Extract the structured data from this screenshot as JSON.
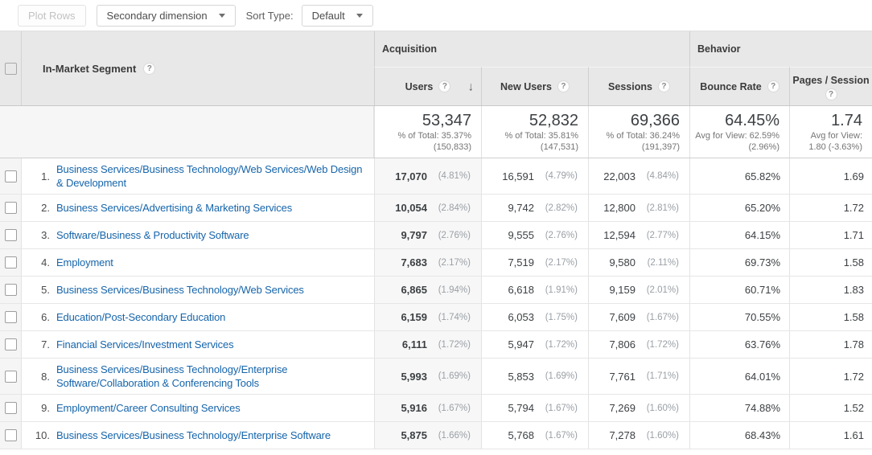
{
  "toolbar": {
    "plot_rows_label": "Plot Rows",
    "secondary_dimension_label": "Secondary dimension",
    "sort_type_label": "Sort Type:",
    "sort_type_value": "Default"
  },
  "table": {
    "dimension_header": "In-Market Segment",
    "help_glyph": "?",
    "sort_arrow_glyph": "↓",
    "groups": {
      "acquisition": "Acquisition",
      "behavior": "Behavior"
    },
    "columns": {
      "users": "Users",
      "new_users": "New Users",
      "sessions": "Sessions",
      "bounce_rate": "Bounce Rate",
      "pages_per_session": "Pages / Session"
    },
    "totals": {
      "users": {
        "value": "53,347",
        "sub1": "% of Total: 35.37%",
        "sub2": "(150,833)"
      },
      "new_users": {
        "value": "52,832",
        "sub1": "% of Total: 35.81%",
        "sub2": "(147,531)"
      },
      "sessions": {
        "value": "69,366",
        "sub1": "% of Total: 36.24%",
        "sub2": "(191,397)"
      },
      "bounce_rate": {
        "value": "64.45%",
        "sub1": "Avg for View: 62.59%",
        "sub2": "(2.96%)"
      },
      "pages_per_session": {
        "value": "1.74",
        "sub1": "Avg for View:",
        "sub2": "1.80 (-3.63%)"
      }
    },
    "rows": [
      {
        "rank": "1.",
        "segment": "Business Services/Business Technology/Web Services/Web Design & Development",
        "users": "17,070",
        "users_pct": "(4.81%)",
        "new_users": "16,591",
        "new_users_pct": "(4.79%)",
        "sessions": "22,003",
        "sessions_pct": "(4.84%)",
        "bounce_rate": "65.82%",
        "pages_per_session": "1.69"
      },
      {
        "rank": "2.",
        "segment": "Business Services/Advertising & Marketing Services",
        "users": "10,054",
        "users_pct": "(2.84%)",
        "new_users": "9,742",
        "new_users_pct": "(2.82%)",
        "sessions": "12,800",
        "sessions_pct": "(2.81%)",
        "bounce_rate": "65.20%",
        "pages_per_session": "1.72"
      },
      {
        "rank": "3.",
        "segment": "Software/Business & Productivity Software",
        "users": "9,797",
        "users_pct": "(2.76%)",
        "new_users": "9,555",
        "new_users_pct": "(2.76%)",
        "sessions": "12,594",
        "sessions_pct": "(2.77%)",
        "bounce_rate": "64.15%",
        "pages_per_session": "1.71"
      },
      {
        "rank": "4.",
        "segment": "Employment",
        "users": "7,683",
        "users_pct": "(2.17%)",
        "new_users": "7,519",
        "new_users_pct": "(2.17%)",
        "sessions": "9,580",
        "sessions_pct": "(2.11%)",
        "bounce_rate": "69.73%",
        "pages_per_session": "1.58"
      },
      {
        "rank": "5.",
        "segment": "Business Services/Business Technology/Web Services",
        "users": "6,865",
        "users_pct": "(1.94%)",
        "new_users": "6,618",
        "new_users_pct": "(1.91%)",
        "sessions": "9,159",
        "sessions_pct": "(2.01%)",
        "bounce_rate": "60.71%",
        "pages_per_session": "1.83"
      },
      {
        "rank": "6.",
        "segment": "Education/Post-Secondary Education",
        "users": "6,159",
        "users_pct": "(1.74%)",
        "new_users": "6,053",
        "new_users_pct": "(1.75%)",
        "sessions": "7,609",
        "sessions_pct": "(1.67%)",
        "bounce_rate": "70.55%",
        "pages_per_session": "1.58"
      },
      {
        "rank": "7.",
        "segment": "Financial Services/Investment Services",
        "users": "6,111",
        "users_pct": "(1.72%)",
        "new_users": "5,947",
        "new_users_pct": "(1.72%)",
        "sessions": "7,806",
        "sessions_pct": "(1.72%)",
        "bounce_rate": "63.76%",
        "pages_per_session": "1.78"
      },
      {
        "rank": "8.",
        "segment": "Business Services/Business Technology/Enterprise Software/Collaboration & Conferencing Tools",
        "users": "5,993",
        "users_pct": "(1.69%)",
        "new_users": "5,853",
        "new_users_pct": "(1.69%)",
        "sessions": "7,761",
        "sessions_pct": "(1.71%)",
        "bounce_rate": "64.01%",
        "pages_per_session": "1.72"
      },
      {
        "rank": "9.",
        "segment": "Employment/Career Consulting Services",
        "users": "5,916",
        "users_pct": "(1.67%)",
        "new_users": "5,794",
        "new_users_pct": "(1.67%)",
        "sessions": "7,269",
        "sessions_pct": "(1.60%)",
        "bounce_rate": "74.88%",
        "pages_per_session": "1.52"
      },
      {
        "rank": "10.",
        "segment": "Business Services/Business Technology/Enterprise Software",
        "users": "5,875",
        "users_pct": "(1.66%)",
        "new_users": "5,768",
        "new_users_pct": "(1.67%)",
        "sessions": "7,278",
        "sessions_pct": "(1.60%)",
        "bounce_rate": "68.43%",
        "pages_per_session": "1.61"
      }
    ]
  },
  "colors": {
    "link": "#1665ab",
    "header_bg": "#e8e8e8",
    "sorted_column_bg": "#f7f7f7",
    "gutter_bg": "#f5f5f5"
  }
}
